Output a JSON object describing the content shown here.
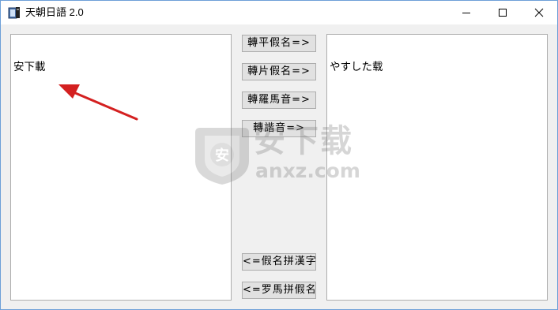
{
  "window": {
    "title": "天朝日語 2.0",
    "controls": [
      "minimize-icon",
      "maximize-icon",
      "close-icon"
    ]
  },
  "input_text": "安下載",
  "output_text": "やすした载",
  "buttons": {
    "to_hiragana": "轉平假名=>",
    "to_katakana": "轉片假名=>",
    "to_romaji": "轉羅馬音=>",
    "to_homophone": "轉諧音=>",
    "kana_to_kanji": "<=假名拼漢字",
    "romaji_to_kana": "<=罗馬拼假名"
  },
  "watermark": {
    "title": "安下载",
    "domain": "anxz.com",
    "badge": "安"
  },
  "annotation": {
    "color": "#d42020",
    "shape": "arrow"
  }
}
